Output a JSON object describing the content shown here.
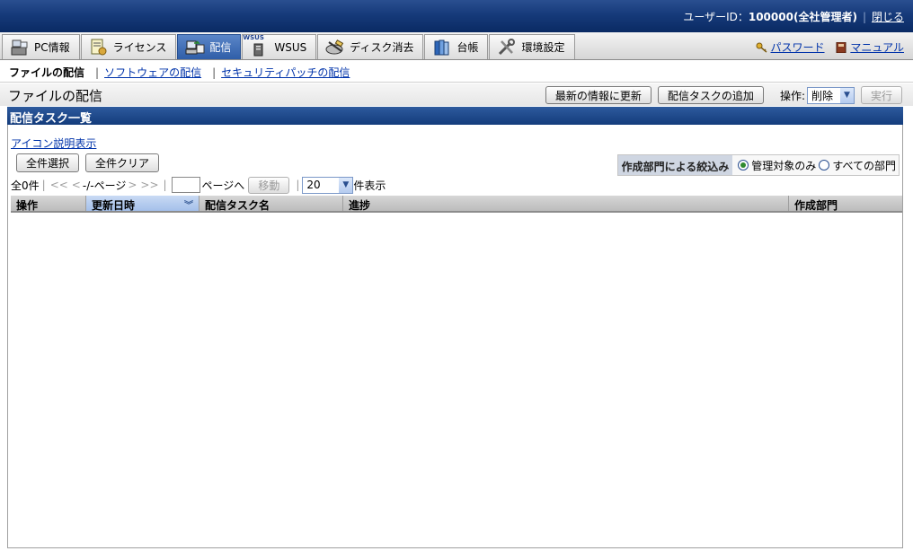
{
  "header": {
    "user_label": "ユーザーID：",
    "user_id": "100000(全社管理者)",
    "close_link": "閉じる"
  },
  "tabs": [
    {
      "label": "PC情報",
      "icon": "pc-info-icon"
    },
    {
      "label": "ライセンス",
      "icon": "license-icon"
    },
    {
      "label": "配信",
      "icon": "distribution-icon",
      "active": true
    },
    {
      "label": "WSUS",
      "icon": "wsus-icon",
      "mini": "WSUS"
    },
    {
      "label": "ディスク消去",
      "icon": "disk-erase-icon"
    },
    {
      "label": "台帳",
      "icon": "ledger-icon"
    },
    {
      "label": "環境設定",
      "icon": "settings-icon"
    }
  ],
  "toplinks": {
    "password": "パスワード",
    "manual": "マニュアル"
  },
  "subnav": {
    "current": "ファイルの配信",
    "software": "ソフトウェアの配信",
    "security": "セキュリティパッチの配信"
  },
  "page": {
    "title": "ファイルの配信",
    "refresh_button": "最新の情報に更新",
    "add_task_button": "配信タスクの追加",
    "operation_label": "操作:",
    "operation_value": "削除",
    "execute_button": "実行"
  },
  "section": {
    "title": "配信タスク一覧"
  },
  "content": {
    "icon_legend_link": "アイコン説明表示",
    "select_all": "全件選択",
    "clear_all": "全件クリア",
    "filter_label": "作成部門による絞込み",
    "filter_option_managed": "管理対象のみ",
    "filter_option_all": "すべての部門",
    "filter_selected": "managed"
  },
  "pager": {
    "total": "全0件",
    "first": "<<",
    "prev": "<",
    "page_text": "-/-ページ",
    "next": ">",
    "last": ">>",
    "goto_suffix": "ページへ",
    "move_button": "移動",
    "per_page": "20",
    "per_page_suffix": "件表示"
  },
  "table": {
    "columns": [
      "操作",
      "更新日時",
      "配信タスク名",
      "進捗",
      "作成部門"
    ],
    "sorted_column": "更新日時",
    "rows": []
  },
  "colors": {
    "header_blue": "#163a7a",
    "section_blue": "#1f4a8c",
    "active_tab": "#3d6db5",
    "link": "#0033aa"
  }
}
